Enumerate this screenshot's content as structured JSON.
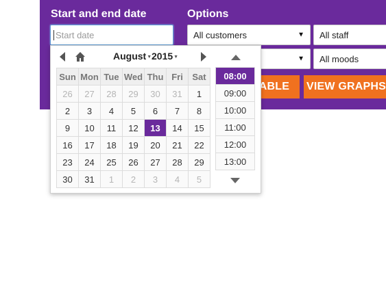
{
  "filters": {
    "date_section_label": "Start and end date",
    "options_section_label": "Options",
    "start_date_placeholder": "Start date",
    "customers_value": "All customers",
    "staff_value": "All staff",
    "moods_value": "All moods",
    "hidden_select_value": ""
  },
  "buttons": {
    "view_table": "TABLE",
    "view_graphs": "VIEW GRAPHS"
  },
  "datepicker": {
    "month": "August",
    "year": "2015",
    "weekdays": [
      "Sun",
      "Mon",
      "Tue",
      "Wed",
      "Thu",
      "Fri",
      "Sat"
    ],
    "weeks": [
      [
        {
          "d": "26",
          "o": true
        },
        {
          "d": "27",
          "o": true
        },
        {
          "d": "28",
          "o": true
        },
        {
          "d": "29",
          "o": true
        },
        {
          "d": "30",
          "o": true
        },
        {
          "d": "31",
          "o": true
        },
        {
          "d": "1",
          "o": false
        }
      ],
      [
        {
          "d": "2",
          "o": false
        },
        {
          "d": "3",
          "o": false
        },
        {
          "d": "4",
          "o": false
        },
        {
          "d": "5",
          "o": false
        },
        {
          "d": "6",
          "o": false
        },
        {
          "d": "7",
          "o": false
        },
        {
          "d": "8",
          "o": false
        }
      ],
      [
        {
          "d": "9",
          "o": false
        },
        {
          "d": "10",
          "o": false
        },
        {
          "d": "11",
          "o": false
        },
        {
          "d": "12",
          "o": false
        },
        {
          "d": "13",
          "o": false,
          "s": true
        },
        {
          "d": "14",
          "o": false
        },
        {
          "d": "15",
          "o": false
        }
      ],
      [
        {
          "d": "16",
          "o": false
        },
        {
          "d": "17",
          "o": false
        },
        {
          "d": "18",
          "o": false
        },
        {
          "d": "19",
          "o": false
        },
        {
          "d": "20",
          "o": false
        },
        {
          "d": "21",
          "o": false
        },
        {
          "d": "22",
          "o": false
        }
      ],
      [
        {
          "d": "23",
          "o": false
        },
        {
          "d": "24",
          "o": false
        },
        {
          "d": "25",
          "o": false
        },
        {
          "d": "26",
          "o": false
        },
        {
          "d": "27",
          "o": false
        },
        {
          "d": "28",
          "o": false
        },
        {
          "d": "29",
          "o": false
        }
      ],
      [
        {
          "d": "30",
          "o": false
        },
        {
          "d": "31",
          "o": false
        },
        {
          "d": "1",
          "o": true
        },
        {
          "d": "2",
          "o": true
        },
        {
          "d": "3",
          "o": true
        },
        {
          "d": "4",
          "o": true
        },
        {
          "d": "5",
          "o": true
        }
      ]
    ],
    "times": [
      "08:00",
      "09:00",
      "10:00",
      "11:00",
      "12:00",
      "13:00"
    ],
    "selected_time": "08:00"
  },
  "colors": {
    "brand": "#6a2a9c",
    "accent": "#f0711f"
  }
}
